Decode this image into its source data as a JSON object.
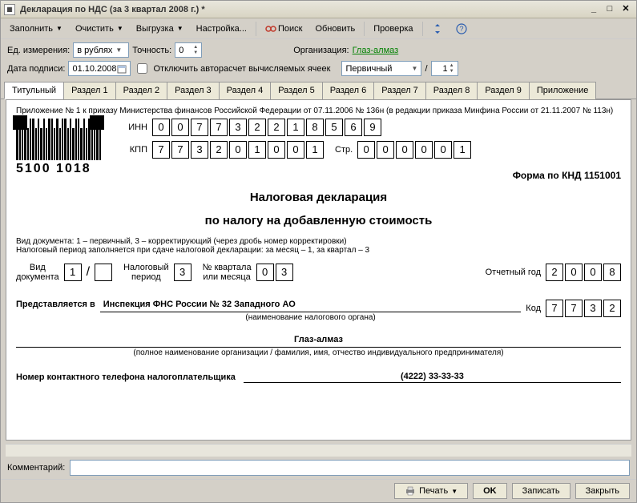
{
  "window": {
    "title": "Декларация по НДС (за 3 квартал 2008 г.) *"
  },
  "toolbar": {
    "fill": "Заполнить",
    "clear": "Очистить",
    "export": "Выгрузка",
    "settings": "Настройка...",
    "search": "Поиск",
    "refresh": "Обновить",
    "check": "Проверка"
  },
  "params": {
    "unit_label": "Ед. измерения:",
    "unit_value": "в рублях",
    "precision_label": "Точность:",
    "precision_value": "0",
    "org_label": "Организация:",
    "org_value": "Глаз-алмаз",
    "date_label": "Дата подписи:",
    "date_value": "01.10.2008",
    "disable_calc": "Отключить авторасчет вычисляемых ячеек",
    "kind_value": "Первичный",
    "seq_value": "1"
  },
  "tabs": [
    "Титульный",
    "Раздел 1",
    "Раздел 2",
    "Раздел 3",
    "Раздел 4",
    "Раздел 5",
    "Раздел 6",
    "Раздел 7",
    "Раздел 8",
    "Раздел 9",
    "Приложение"
  ],
  "form": {
    "annex": "Приложение № 1 к приказу Министерства финансов Российской Федерации от 07.11.2006 № 136н (в редакции приказа Минфина России от 21.11.2007 № 113н)",
    "barcode_text": "5100 1018",
    "inn_label": "ИНН",
    "inn": [
      "0",
      "0",
      "7",
      "7",
      "3",
      "2",
      "2",
      "1",
      "8",
      "5",
      "6",
      "9"
    ],
    "kpp_label": "КПП",
    "kpp": [
      "7",
      "7",
      "3",
      "2",
      "0",
      "1",
      "0",
      "0",
      "1"
    ],
    "page_label": "Стр.",
    "page": [
      "0",
      "0",
      "0",
      "0",
      "0",
      "1"
    ],
    "form_code": "Форма по КНД 1151001",
    "title1": "Налоговая декларация",
    "title2": "по налогу на добавленную стоимость",
    "help1": "Вид документа: 1 – первичный, 3 – корректирующий (через дробь номер корректировки)",
    "help2": "Налоговый период заполняется при сдаче налоговой декларации: за месяц – 1, за квартал – 3",
    "doc_kind_label": "Вид\nдокумента",
    "doc_kind": "1",
    "tax_period_label": "Налоговый\nпериод",
    "tax_period": "3",
    "qm_label": "№ квартала\nили месяца",
    "qm": [
      "0",
      "3"
    ],
    "year_label": "Отчетный год",
    "year": [
      "2",
      "0",
      "0",
      "8"
    ],
    "present_label": "Представляется в",
    "authority": "Инспекция ФНС России № 32 Западного АО",
    "authority_caption": "(наименование налогового органа)",
    "code_label": "Код",
    "code": [
      "7",
      "7",
      "3",
      "2"
    ],
    "org_name": "Глаз-алмаз",
    "org_caption": "(полное наименование организации / фамилия, имя, отчество индивидуального предпринимателя)",
    "phone_label": "Номер контактного телефона налогоплательщика",
    "phone_value": "(4222) 33-33-33"
  },
  "comment_label": "Комментарий:",
  "footer": {
    "print": "Печать",
    "ok": "OK",
    "save": "Записать",
    "close": "Закрыть"
  }
}
